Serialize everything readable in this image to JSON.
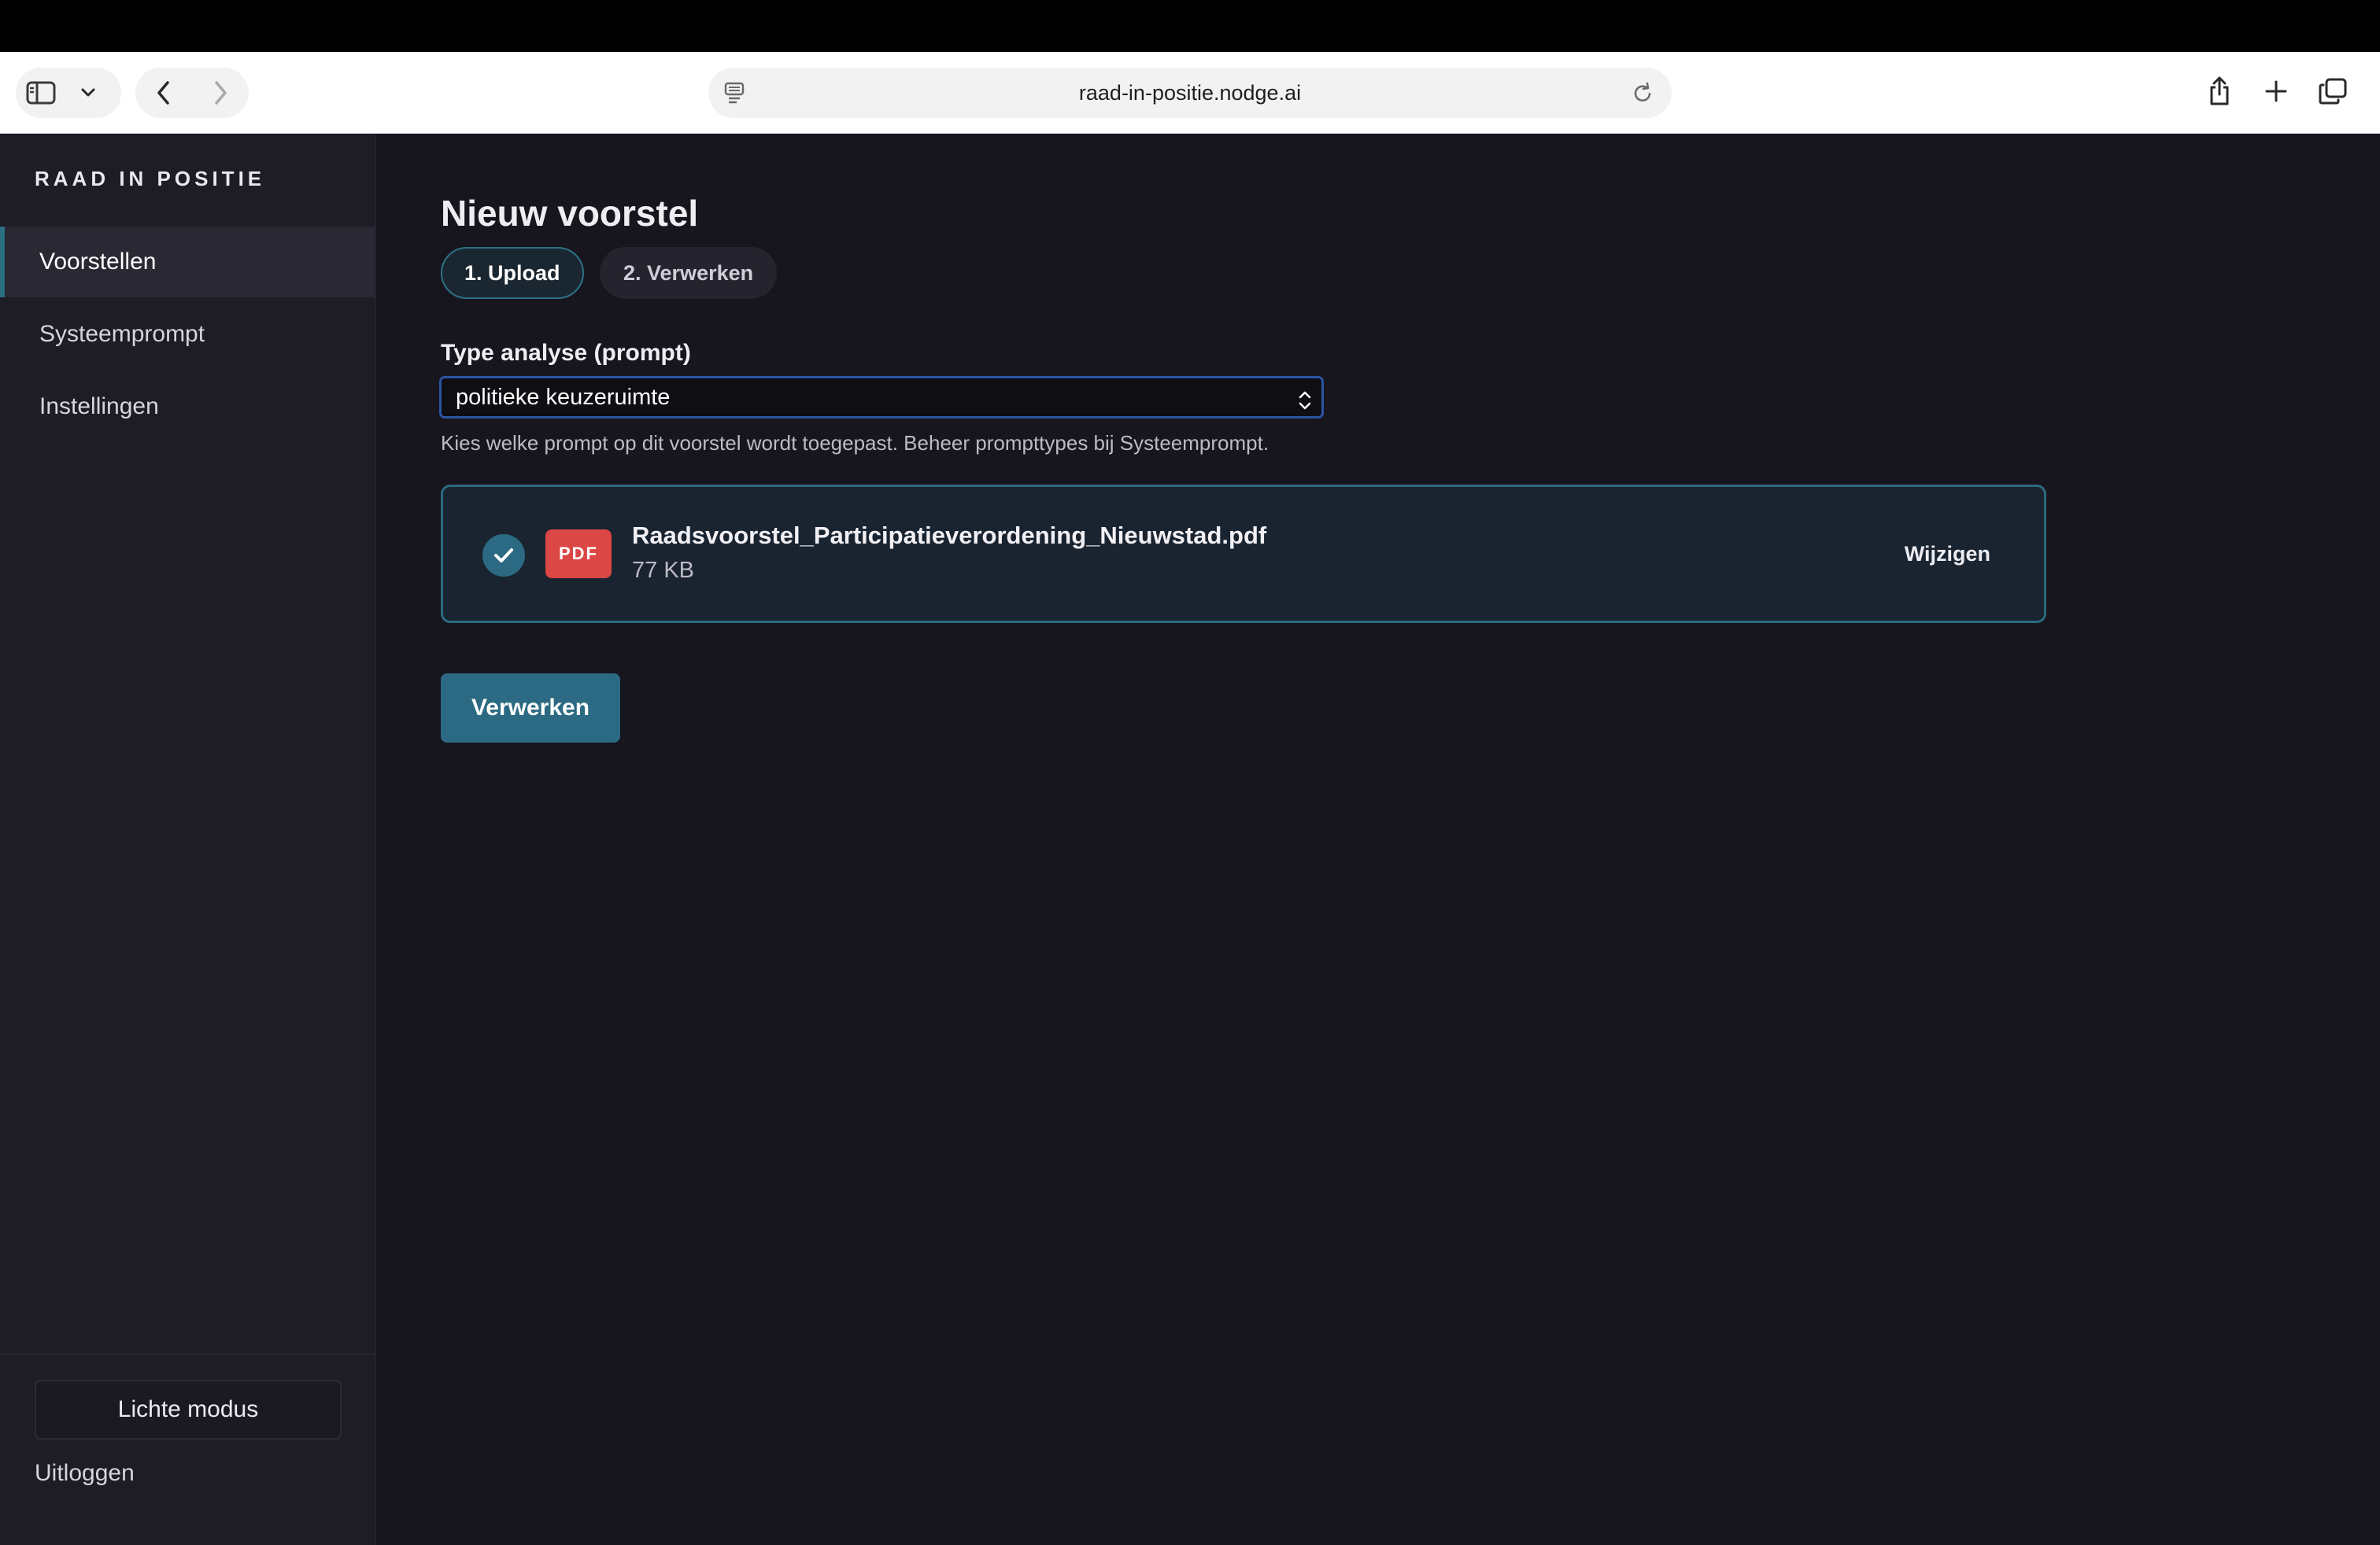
{
  "browser": {
    "url": "raad-in-positie.nodge.ai"
  },
  "sidebar": {
    "brand": "RAAD IN POSITIE",
    "items": [
      {
        "label": "Voorstellen",
        "active": true
      },
      {
        "label": "Systeemprompt",
        "active": false
      },
      {
        "label": "Instellingen",
        "active": false
      }
    ],
    "theme_toggle": "Lichte modus",
    "logout": "Uitloggen"
  },
  "main": {
    "title": "Nieuw voorstel",
    "steps": [
      {
        "label": "1. Upload",
        "active": true
      },
      {
        "label": "2. Verwerken",
        "active": false
      }
    ],
    "prompt_field": {
      "label": "Type analyse (prompt)",
      "value": "politieke keuzeruimte",
      "helper": "Kies welke prompt op dit voorstel wordt toegepast. Beheer prompttypes bij Systeemprompt."
    },
    "file": {
      "badge": "PDF",
      "name": "Raadsvoorstel_Participatieverordening_Nieuwstad.pdf",
      "size": "77 KB",
      "change_label": "Wijzigen"
    },
    "submit_label": "Verwerken"
  },
  "colors": {
    "accent": "#2b6a82",
    "background": "#17151d",
    "sidebar": "#1e1c25",
    "pdf_badge": "#db4744",
    "focus_ring": "#2c54a3"
  },
  "icons": [
    "sidebar-toggle-icon",
    "chevron-down-icon",
    "back-icon",
    "forward-icon",
    "reader-icon",
    "reload-icon",
    "share-icon",
    "new-tab-icon",
    "tabs-overview-icon",
    "checkmark-icon",
    "select-chevrons-icon"
  ]
}
